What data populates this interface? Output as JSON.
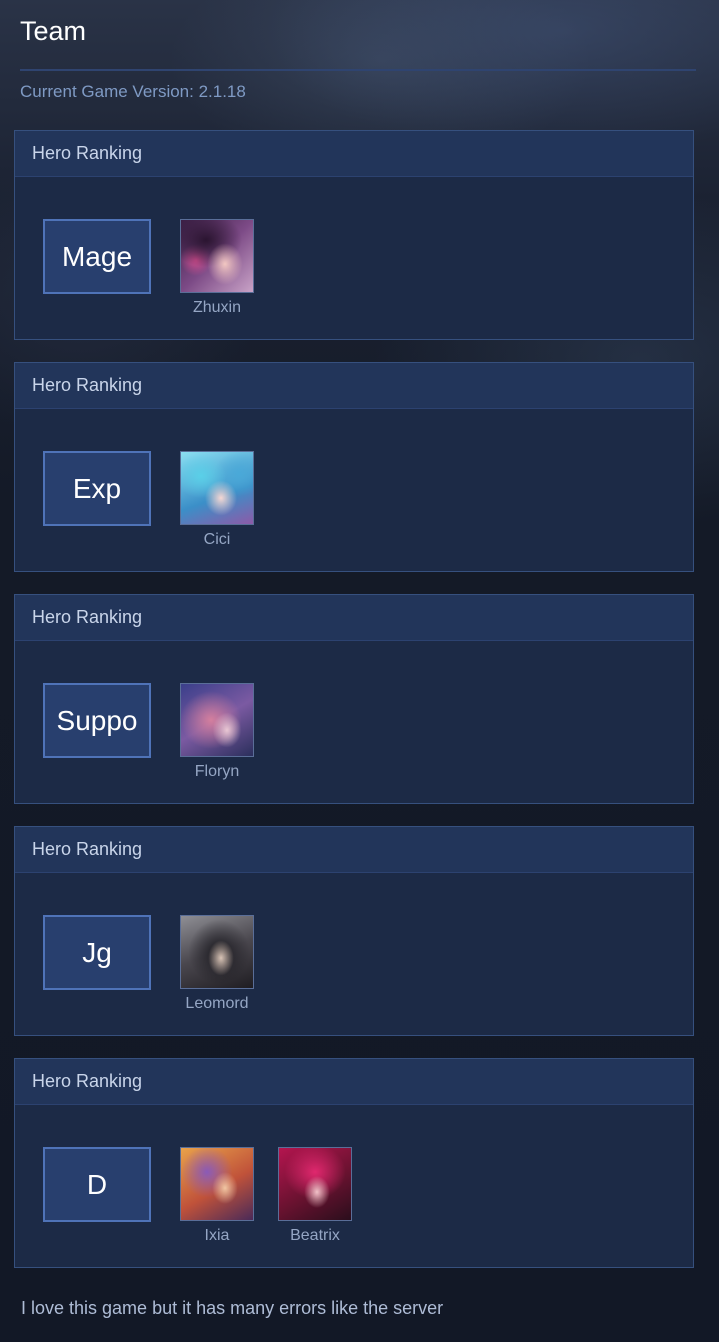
{
  "header": {
    "title": "Team",
    "version_text": "Current Game Version: 2.1.18"
  },
  "colors": {
    "accent": "#4f73b8",
    "card_bg": "#1c2a46",
    "header_bg": "#22355a",
    "muted_text": "#95a6c4"
  },
  "cards": [
    {
      "header": "Hero Ranking",
      "role": "Mage",
      "heroes": [
        {
          "name": "Zhuxin",
          "icon": "zhuxin-portrait"
        }
      ]
    },
    {
      "header": "Hero Ranking",
      "role": "Exp",
      "heroes": [
        {
          "name": "Cici",
          "icon": "cici-portrait"
        }
      ]
    },
    {
      "header": "Hero Ranking",
      "role": "Suppo",
      "heroes": [
        {
          "name": "Floryn",
          "icon": "floryn-portrait"
        }
      ]
    },
    {
      "header": "Hero Ranking",
      "role": "Jg",
      "heroes": [
        {
          "name": "Leomord",
          "icon": "leomord-portrait"
        }
      ]
    },
    {
      "header": "Hero Ranking",
      "role": "D",
      "heroes": [
        {
          "name": "Ixia",
          "icon": "ixia-portrait"
        },
        {
          "name": "Beatrix",
          "icon": "beatrix-portrait"
        }
      ]
    }
  ],
  "footer": {
    "comment": "I love this game but it has many errors like the server"
  }
}
